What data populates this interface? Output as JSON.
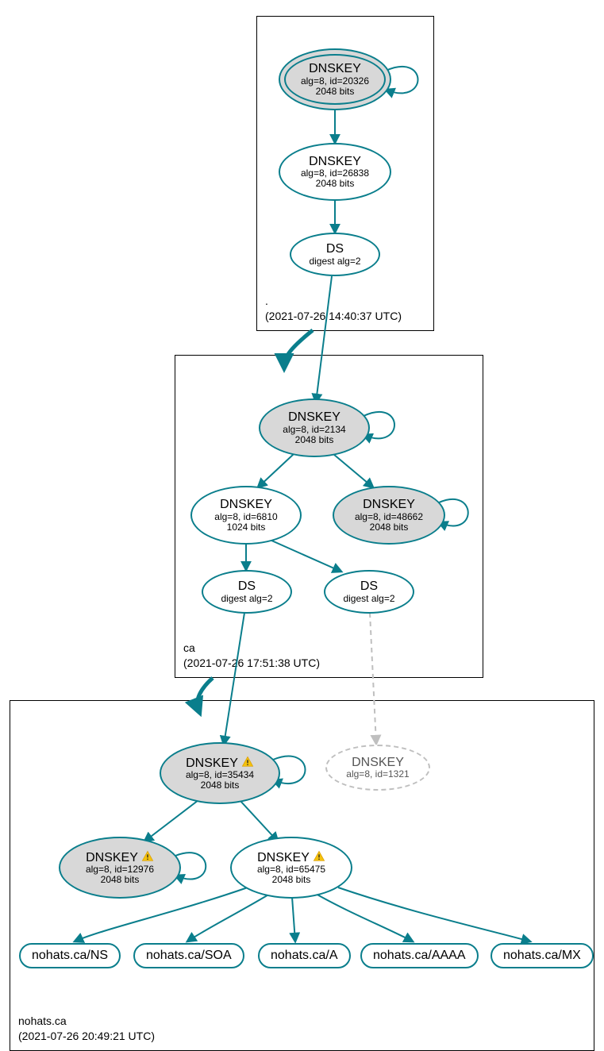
{
  "zones": {
    "root": {
      "name": ".",
      "timestamp": "(2021-07-26 14:40:37 UTC)"
    },
    "ca": {
      "name": "ca",
      "timestamp": "(2021-07-26 17:51:38 UTC)"
    },
    "nohats": {
      "name": "nohats.ca",
      "timestamp": "(2021-07-26 20:49:21 UTC)"
    }
  },
  "nodes": {
    "root_ksk": {
      "title": "DNSKEY",
      "line2": "alg=8, id=20326",
      "line3": "2048 bits"
    },
    "root_zsk": {
      "title": "DNSKEY",
      "line2": "alg=8, id=26838",
      "line3": "2048 bits"
    },
    "root_ds": {
      "title": "DS",
      "line2": "digest alg=2"
    },
    "ca_ksk": {
      "title": "DNSKEY",
      "line2": "alg=8, id=2134",
      "line3": "2048 bits"
    },
    "ca_zsk": {
      "title": "DNSKEY",
      "line2": "alg=8, id=6810",
      "line3": "1024 bits"
    },
    "ca_ksk2": {
      "title": "DNSKEY",
      "line2": "alg=8, id=48662",
      "line3": "2048 bits"
    },
    "ca_ds1": {
      "title": "DS",
      "line2": "digest alg=2"
    },
    "ca_ds2": {
      "title": "DS",
      "line2": "digest alg=2"
    },
    "nh_ksk": {
      "title": "DNSKEY",
      "line2": "alg=8, id=35434",
      "line3": "2048 bits",
      "warn": true
    },
    "nh_missing": {
      "title": "DNSKEY",
      "line2": "alg=8, id=1321"
    },
    "nh_key2": {
      "title": "DNSKEY",
      "line2": "alg=8, id=12976",
      "line3": "2048 bits",
      "warn": true
    },
    "nh_zsk": {
      "title": "DNSKEY",
      "line2": "alg=8, id=65475",
      "line3": "2048 bits",
      "warn": true
    }
  },
  "rr": {
    "ns": "nohats.ca/NS",
    "soa": "nohats.ca/SOA",
    "a": "nohats.ca/A",
    "aaaa": "nohats.ca/AAAA",
    "mx": "nohats.ca/MX"
  },
  "colors": {
    "accent": "#0a7e8c",
    "fill": "#d8d8d8",
    "faded": "#bfbfbf"
  }
}
